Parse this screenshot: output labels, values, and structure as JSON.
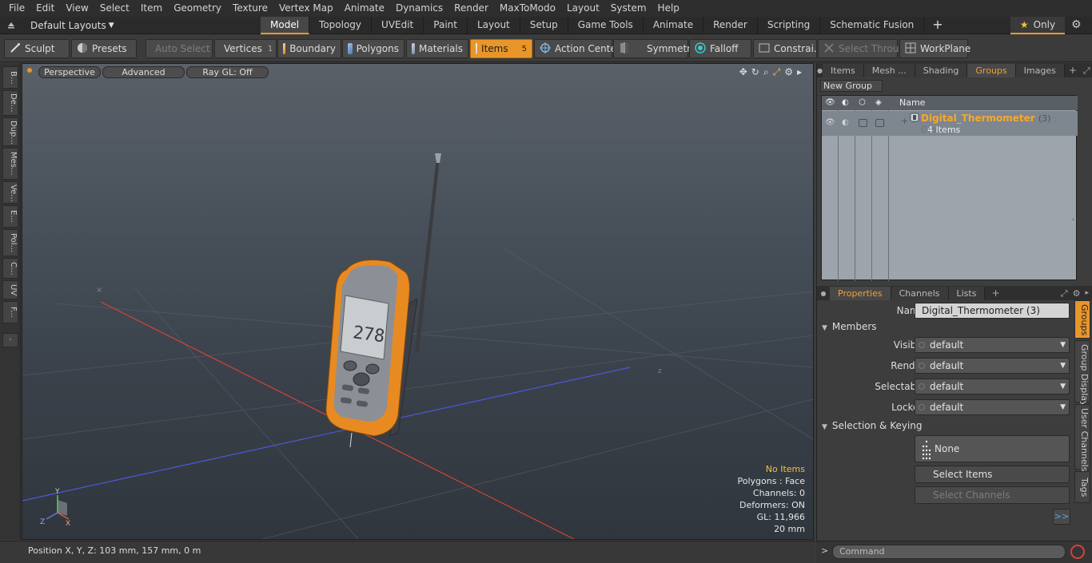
{
  "menubar": {
    "items": [
      "File",
      "Edit",
      "View",
      "Select",
      "Item",
      "Geometry",
      "Texture",
      "Vertex Map",
      "Animate",
      "Dynamics",
      "Render",
      "MaxToModo",
      "Layout",
      "System",
      "Help"
    ]
  },
  "layoutbar": {
    "layout_selector": "Default Layouts",
    "mode_tabs": [
      "Model",
      "Topology",
      "UVEdit",
      "Paint",
      "Layout",
      "Setup",
      "Game Tools",
      "Animate",
      "Render",
      "Scripting",
      "Schematic Fusion"
    ],
    "active_tab": "Model",
    "only_label": "Only"
  },
  "toolbar": {
    "sculpt": "Sculpt",
    "presets": "Presets",
    "auto_select": "Auto Select",
    "vertices": "Vertices",
    "vertices_count": "1",
    "boundary": "Boundary",
    "polygons": "Polygons",
    "materials": "Materials",
    "items": "Items",
    "items_count": "5",
    "action_center": "Action Center",
    "symmetry": "Symmetry",
    "falloff": "Falloff",
    "constraints": "Constrai...",
    "select_through": "Select Through",
    "workplane": "WorkPlane"
  },
  "left_tabs": [
    "B...",
    "De...",
    "Dup...",
    "Mes...",
    "Ve...",
    "E...",
    "Pol...",
    "C...",
    "UV",
    "F..."
  ],
  "viewport": {
    "view_mode": "Perspective",
    "shading": "Advanced",
    "raygl": "Ray GL: Off",
    "lcd_reading": "278",
    "axis_labels": {
      "x": "X",
      "y": "Y",
      "z": "Z"
    },
    "hud": {
      "no_items": "No Items",
      "polygons": "Polygons : Face",
      "channels": "Channels: 0",
      "deformers": "Deformers: ON",
      "gl": "GL: 11,966",
      "scale": "20 mm"
    }
  },
  "statusbar": {
    "position": "Position X, Y, Z:   103 mm, 157 mm, 0 m"
  },
  "groups_panel": {
    "tabs": [
      "Items",
      "Mesh ...",
      "Shading",
      "Groups",
      "Images"
    ],
    "active_tab": "Groups",
    "new_group": "New Group",
    "column_name": "Name",
    "group": {
      "name": "Digital_Thermometer",
      "count": "(3)",
      "type": ": Group",
      "items": "4 Items"
    }
  },
  "properties_panel": {
    "tabs": [
      "Properties",
      "Channels",
      "Lists"
    ],
    "active_tab": "Properties",
    "name_label": "Name",
    "name_value": "Digital_Thermometer (3)",
    "members_section": "Members",
    "fields": [
      {
        "label": "Visible",
        "value": "default"
      },
      {
        "label": "Render",
        "value": "default"
      },
      {
        "label": "Selectable",
        "value": "default"
      },
      {
        "label": "Locked",
        "value": "default"
      }
    ],
    "selection_section": "Selection & Keying",
    "none_button": "None",
    "select_items": "Select Items",
    "select_channels": "Select Channels",
    "more": ">>",
    "side_tabs": [
      "Groups",
      "Group Display",
      "User Channels",
      "Tags"
    ]
  },
  "command": {
    "prompt": ">",
    "placeholder": "Command"
  },
  "colors": {
    "accent": "#e8962a",
    "group_name": "#f4a830",
    "hud_warn": "#f0c040"
  }
}
